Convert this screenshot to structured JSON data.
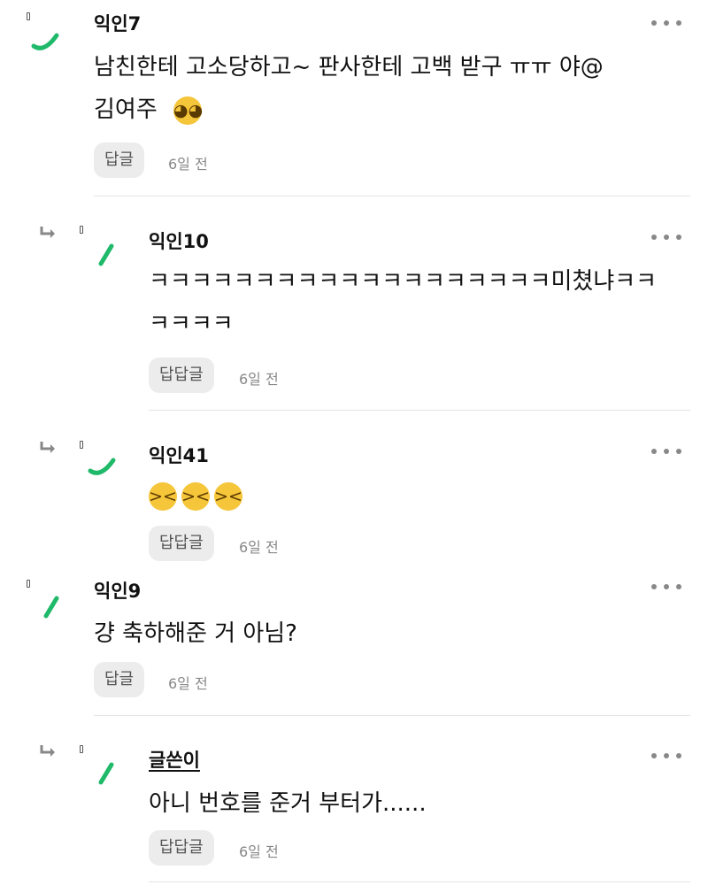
{
  "comments": [
    {
      "author": "익인7",
      "text_line1": "남친한테 고소당하고~ 판사한테 고백 받구 ㅠㅠ 야@",
      "text_line2": "김여주",
      "emoji_icon": "pleading-face-emoji",
      "reply_label": "답글",
      "time": "6일 전"
    },
    {
      "author": "익인10",
      "text_line1": "ㅋㅋㅋㅋㅋㅋㅋㅋㅋㅋㅋㅋㅋㅋㅋㅋㅋㅋㅋ미쳤냐ㅋㅋ",
      "text_line2": "ㅋㅋㅋㅋ",
      "reply_label": "답답글",
      "time": "6일 전"
    },
    {
      "author": "익인41",
      "emoji_icons": [
        "grinning-squinting-face-emoji",
        "grinning-squinting-face-emoji",
        "grinning-squinting-face-emoji"
      ],
      "reply_label": "답답글",
      "time": "6일 전"
    },
    {
      "author": "익인9",
      "text_line1": "걍 축하해준 거 아님?",
      "reply_label": "답글",
      "time": "6일 전"
    },
    {
      "author": "글쓴이",
      "text_line1": "아니 번호를 준거 부터가......",
      "reply_label": "답답글",
      "time": "6일 전"
    }
  ],
  "colors": {
    "avatar_accent": "#1fb96a",
    "reply_button_bg": "#ececec",
    "more_dots": "#888888"
  }
}
